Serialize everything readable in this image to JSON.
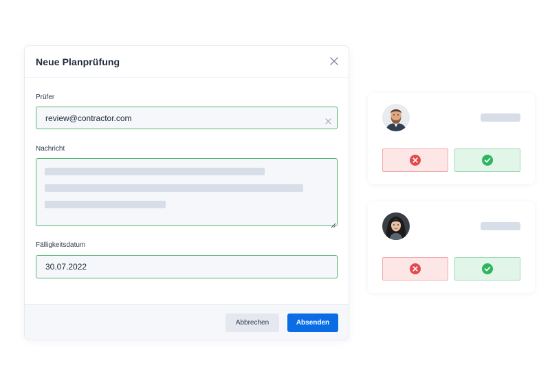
{
  "modal": {
    "title": "Neue Planprüfung",
    "reviewer": {
      "label": "Prüfer",
      "value": "review@contractor.com"
    },
    "message": {
      "label": "Nachricht"
    },
    "due_date": {
      "label": "Fälligkeitsdatum",
      "value": "30.07.2022"
    },
    "buttons": {
      "cancel": "Abbrechen",
      "submit": "Absenden"
    }
  },
  "review_cards": [
    {
      "avatar": "avatar-man-beard-icon",
      "reject_icon": "x-circle-icon",
      "approve_icon": "check-circle-icon"
    },
    {
      "avatar": "avatar-woman-dark-hair-icon",
      "reject_icon": "x-circle-icon",
      "approve_icon": "check-circle-icon"
    }
  ],
  "colors": {
    "accent": "#0a6de6",
    "valid_border": "#4fb56e",
    "reject": "#e5484d",
    "approve": "#2fb55d"
  }
}
